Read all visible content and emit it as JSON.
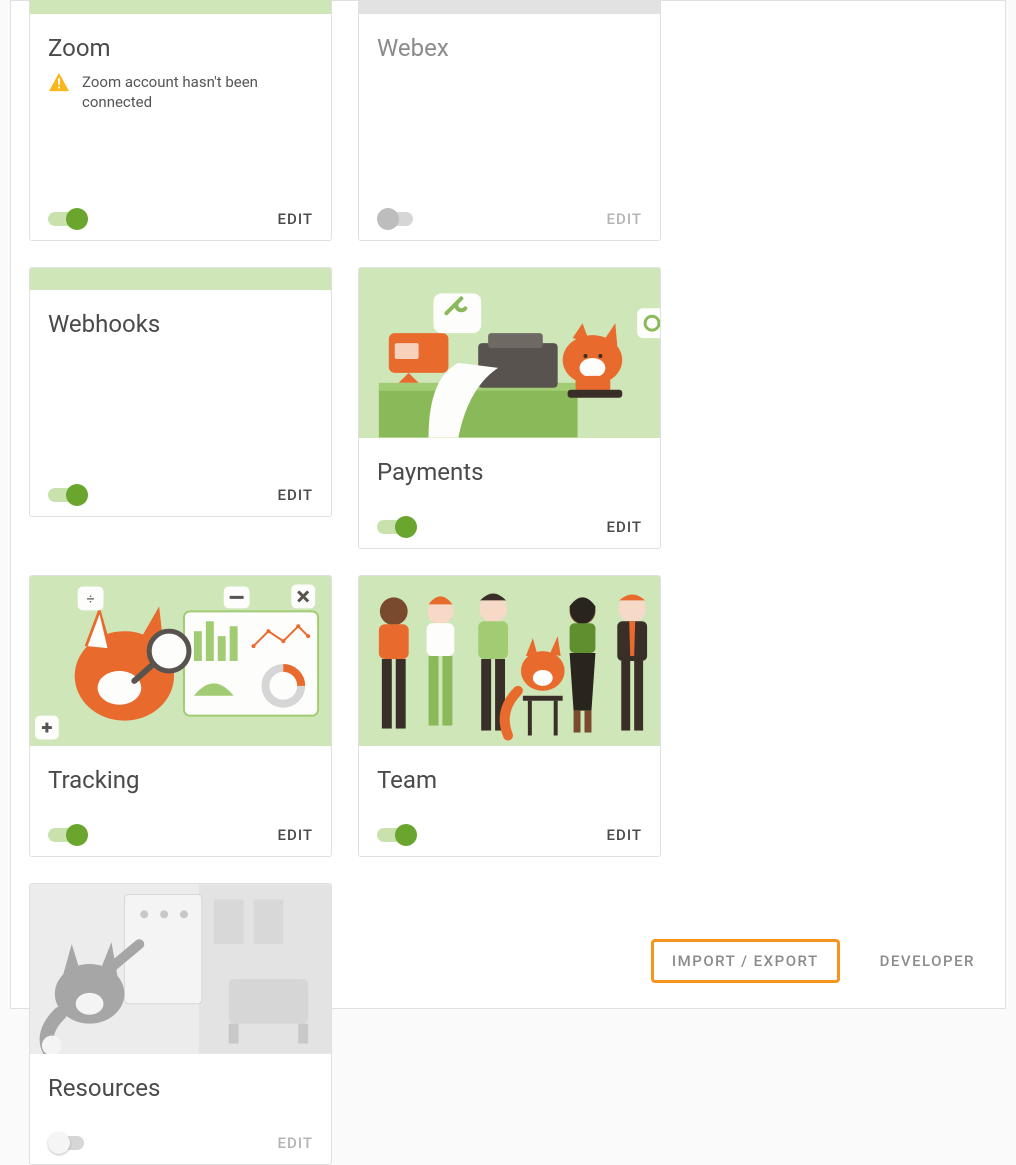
{
  "cards": [
    {
      "id": "zoom",
      "title": "Zoom",
      "warning": "Zoom account hasn't been connected",
      "enabled": true,
      "edit": "EDIT",
      "muted_edit": false,
      "title_muted": false,
      "image": "short-green"
    },
    {
      "id": "webex",
      "title": "Webex",
      "enabled": false,
      "edit": "EDIT",
      "muted_edit": true,
      "title_muted": true,
      "image": "short-grey"
    },
    {
      "id": "webhooks",
      "title": "Webhooks",
      "enabled": true,
      "edit": "EDIT",
      "muted_edit": false,
      "title_muted": false,
      "image": "short-green"
    },
    {
      "id": "payments",
      "title": "Payments",
      "enabled": true,
      "edit": "EDIT",
      "muted_edit": false,
      "title_muted": false,
      "image": "payments"
    },
    {
      "id": "tracking",
      "title": "Tracking",
      "enabled": true,
      "edit": "EDIT",
      "muted_edit": false,
      "title_muted": false,
      "image": "tracking"
    },
    {
      "id": "team",
      "title": "Team",
      "enabled": true,
      "edit": "EDIT",
      "muted_edit": false,
      "title_muted": false,
      "image": "team"
    },
    {
      "id": "resources",
      "title": "Resources",
      "enabled": false,
      "off_style": "off2",
      "edit": "EDIT",
      "muted_edit": true,
      "title_muted": false,
      "image": "resources"
    }
  ],
  "actions": {
    "import_export": "IMPORT / EXPORT",
    "developer": "DEVELOPER"
  }
}
